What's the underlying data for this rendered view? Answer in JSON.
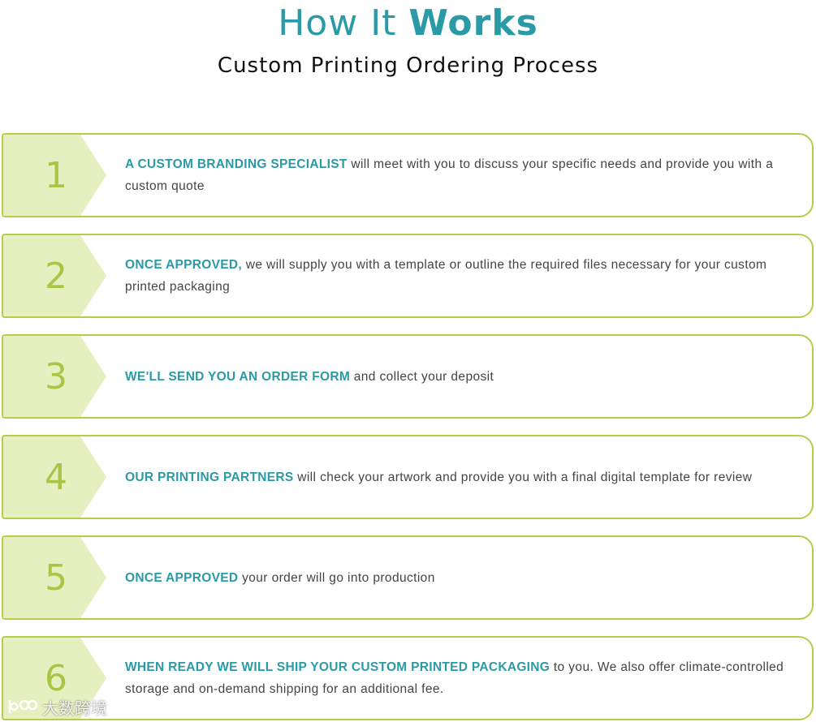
{
  "header": {
    "title_light": "How It ",
    "title_bold": "Works",
    "subtitle": "Custom Printing Ordering Process"
  },
  "colors": {
    "accent_teal": "#2a9aa6",
    "border_green": "#b5cd47",
    "badge_fill": "#e6efbf",
    "number_green": "#a9c545"
  },
  "steps": [
    {
      "number": "1",
      "highlight": "A CUSTOM BRANDING SPECIALIST",
      "text": " will meet with you to discuss your specific needs and provide you with a custom quote"
    },
    {
      "number": "2",
      "highlight": "ONCE APPROVED,",
      "text": " we will supply you with a template or outline the required files necessary for your custom printed packaging"
    },
    {
      "number": "3",
      "highlight": "WE'LL SEND YOU AN ORDER FORM",
      "text": " and collect your deposit"
    },
    {
      "number": "4",
      "highlight": "OUR PRINTING PARTNERS",
      "text": " will check your artwork and provide you with a final digital template for review"
    },
    {
      "number": "5",
      "highlight": "ONCE APPROVED",
      "text": " your order will go into production"
    },
    {
      "number": "6",
      "highlight": "WHEN READY WE WILL SHIP YOUR CUSTOM PRINTED PACKAGING",
      "text": " to you. We also offer climate-controlled storage and on-demand shipping for an additional fee."
    }
  ],
  "watermark": "大数跨境"
}
